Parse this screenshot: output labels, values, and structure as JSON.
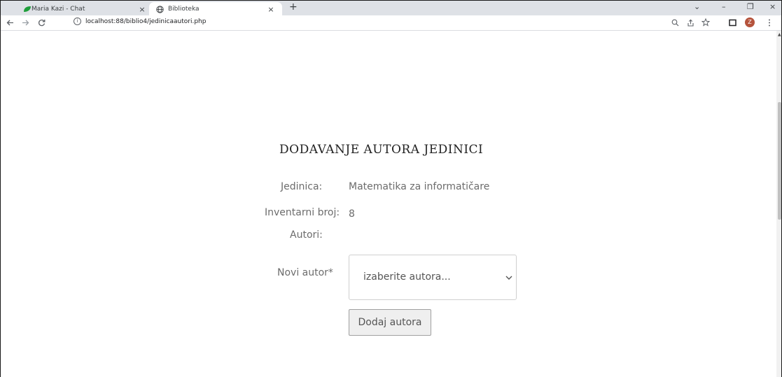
{
  "browser": {
    "tabs": [
      {
        "title": "Maria Kazi - Chat",
        "icon": "leaf-icon"
      },
      {
        "title": "Biblioteka",
        "icon": "globe-icon"
      }
    ],
    "new_tab": "+",
    "close_glyph": "×",
    "window_controls": {
      "tabsearch": "⌄",
      "minimize": "–",
      "restore": "❐",
      "close": "×"
    },
    "url": "localhost:88/biblio4/jedinicaautori.php",
    "info_glyph": "i",
    "avatar_letter": "Z",
    "avatar_color": "#b5533c"
  },
  "form": {
    "heading": "DODAVANJE AUTORA JEDINICI",
    "jedinica_label": "Jedinica:",
    "jedinica_value": "Matematika za informatičare",
    "inventarni_label": "Inventarni broj:",
    "inventarni_value": "8",
    "autori_label": "Autori:",
    "novi_autor_label": "Novi autor*",
    "select_placeholder": "izaberite autora...",
    "submit_label": "Dodaj autora"
  }
}
